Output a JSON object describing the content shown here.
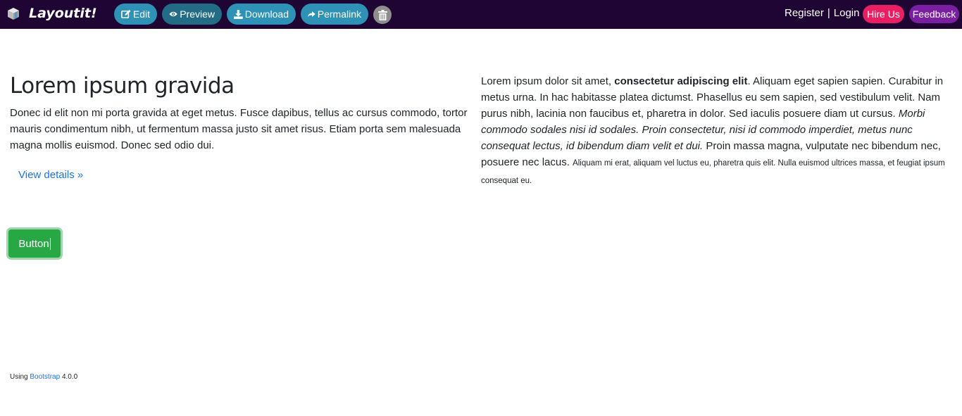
{
  "topbar": {
    "brand": "Layoutit!",
    "buttons": {
      "edit": "Edit",
      "preview": "Preview",
      "download": "Download",
      "permalink": "Permalink"
    },
    "register": "Register",
    "separator": "|",
    "login": "Login",
    "hire_us": "Hire Us",
    "feedback": "Feedback",
    "colors": {
      "bar": "#1f0533",
      "button": "#2d92b5",
      "button_active": "#226c85",
      "hire": "#e91e63",
      "feedback": "#7b1fa2"
    }
  },
  "content": {
    "heading": "Lorem ipsum gravida",
    "lead": "Donec id elit non mi porta gravida at eget metus. Fusce dapibus, tellus ac cursus commodo, tortor mauris condimentum nibh, ut fermentum massa justo sit amet risus. Etiam porta sem malesuada magna mollis euismod. Donec sed odio dui.",
    "view_details": "View details »",
    "right": {
      "part1": "Lorem ipsum dolor sit amet, ",
      "bold": "consectetur adipiscing elit",
      "part2": ". Aliquam eget sapien sapien. Curabitur in metus urna. In hac habitasse platea dictumst. Phasellus eu sem sapien, sed vestibulum velit. Nam purus nibh, lacinia non faucibus et, pharetra in dolor. Sed iaculis posuere diam ut cursus. ",
      "italic": "Morbi commodo sodales nisi id sodales. Proin consectetur, nisi id commodo imperdiet, metus nunc consequat lectus, id bibendum diam velit et dui.",
      "part3": " Proin massa magna, vulputate nec bibendum nec, posuere nec lacus. ",
      "small": "Aliquam mi erat, aliquam vel luctus eu, pharetra quis elit. Nulla euismod ultrices massa, et feugiat ipsum consequat eu."
    },
    "button_label": "Button",
    "button_color": "#28a745"
  },
  "footer": {
    "prefix": "Using ",
    "link": "Bootstrap",
    "version": " 4.0.0"
  }
}
